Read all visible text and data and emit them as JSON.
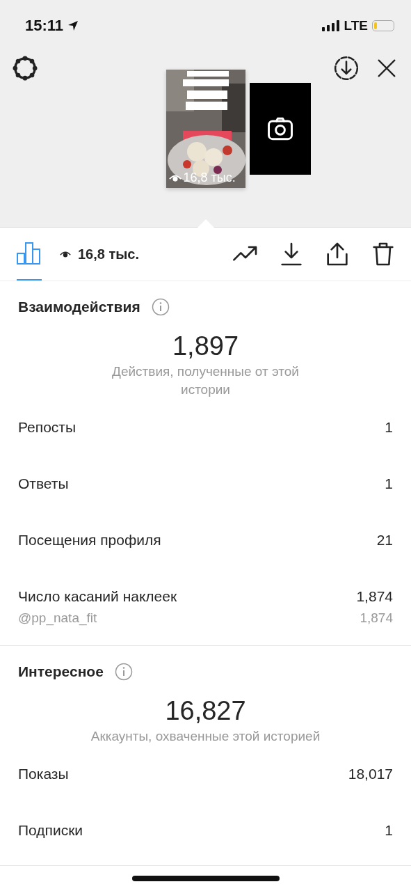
{
  "status_bar": {
    "time": "15:11",
    "network": "LTE",
    "battery": {
      "level": 0.15
    }
  },
  "stories": [
    {
      "kind": "picture",
      "views": "16,8 тыс."
    },
    {
      "kind": "camera"
    }
  ],
  "toolbar": {
    "tabs": [
      {
        "kind": "stats",
        "selected": true
      }
    ],
    "views": "16,8 тыс.",
    "actions": [
      {
        "kind": "trend"
      },
      {
        "kind": "download"
      },
      {
        "kind": "share"
      },
      {
        "kind": "delete"
      }
    ]
  },
  "sections": [
    {
      "title": "Взаимодействия",
      "total": "1,897",
      "caption": "Действия, полученные от этой истории",
      "rows": [
        {
          "kind": "main",
          "label": "Репосты",
          "value": "1"
        },
        {
          "kind": "main",
          "label": "Ответы",
          "value": "1"
        },
        {
          "kind": "main",
          "label": "Посещения профиля",
          "value": "21"
        },
        {
          "kind": "main",
          "label": "Число касаний наклеек",
          "value": "1,874"
        },
        {
          "kind": "sub",
          "label": "@pp_nata_fit",
          "value": "1,874"
        }
      ]
    },
    {
      "title": "Интересное",
      "total": "16,827",
      "caption": "Аккаунты, охваченные этой историей",
      "rows": [
        {
          "kind": "main",
          "label": "Показы",
          "value": "18,017"
        },
        {
          "kind": "main",
          "label": "Подписки",
          "value": "1"
        }
      ]
    }
  ]
}
